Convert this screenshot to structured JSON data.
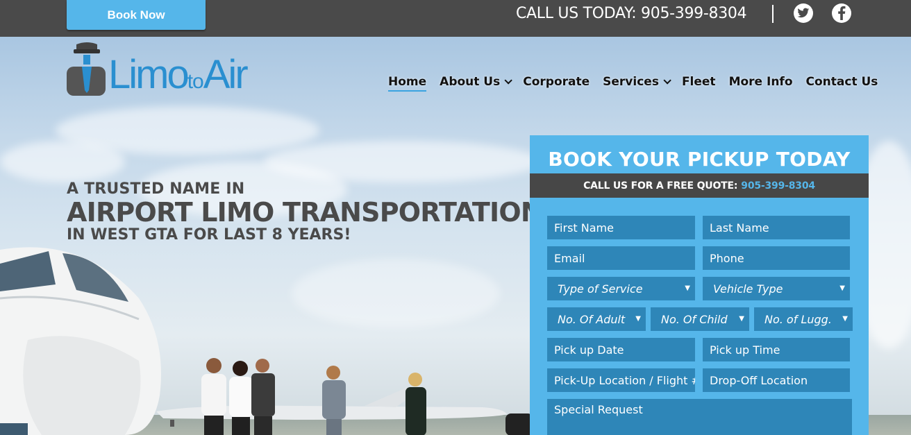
{
  "topbar": {
    "book_label": "Book Now",
    "call_text": "CALL US TODAY: 905-399-8304",
    "social": [
      {
        "name": "twitter",
        "icon": "twitter-icon"
      },
      {
        "name": "facebook",
        "icon": "facebook-icon"
      }
    ]
  },
  "logo": {
    "part1": "Limo",
    "part2": "to",
    "part3": "Air"
  },
  "nav": {
    "items": [
      {
        "label": "Home",
        "active": true,
        "dropdown": false
      },
      {
        "label": "About Us",
        "active": false,
        "dropdown": true
      },
      {
        "label": "Corporate",
        "active": false,
        "dropdown": false
      },
      {
        "label": "Services",
        "active": false,
        "dropdown": true
      },
      {
        "label": "Fleet",
        "active": false,
        "dropdown": false
      },
      {
        "label": "More Info",
        "active": false,
        "dropdown": false
      },
      {
        "label": "Contact Us",
        "active": false,
        "dropdown": false
      }
    ]
  },
  "hero": {
    "line1": "A TRUSTED NAME IN",
    "line2": "AIRPORT LIMO TRANSPORTATION",
    "line3": "IN WEST GTA FOR LAST 8 YEARS!"
  },
  "booking": {
    "title": "BOOK YOUR PICKUP TODAY",
    "quote_label": "CALL US FOR A FREE QUOTE:",
    "quote_phone": "905-399-8304",
    "fields": {
      "first_name": "First Name",
      "last_name": "Last Name",
      "email": "Email",
      "phone": "Phone",
      "service_type": "Type of Service",
      "vehicle_type": "Vehicle Type",
      "adults": "No. Of Adult",
      "children": "No. Of Child",
      "luggage": "No. of Lugg.",
      "pickup_date": "Pick up Date",
      "pickup_time": "Pick up Time",
      "pickup_location": "Pick-Up Location / Flight #",
      "dropoff_location": "Drop-Off Location",
      "special_request": "Special Request"
    }
  },
  "colors": {
    "accent": "#55b6ea",
    "field_bg": "#2e86b8",
    "topbar_bg": "#4a4a4a",
    "headline": "#4a4a4a"
  }
}
